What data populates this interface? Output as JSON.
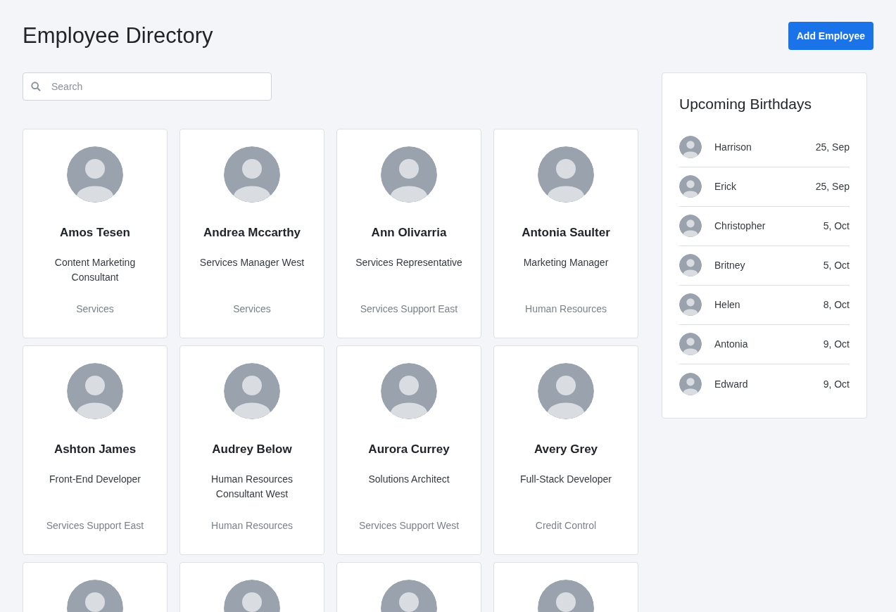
{
  "header": {
    "title": "Employee Directory",
    "add_button": "Add Employee"
  },
  "search": {
    "placeholder": "Search"
  },
  "cards": [
    {
      "kind": "full",
      "name": "Amos Tesen",
      "role": "Content Marketing Consultant",
      "department": "Services"
    },
    {
      "kind": "full",
      "name": "Andrea Mccarthy",
      "role": "Services Manager West",
      "department": "Services"
    },
    {
      "kind": "full",
      "name": "Ann Olivarria",
      "role": "Services Representative",
      "department": "Services Support East"
    },
    {
      "kind": "full",
      "name": "Antonia Saulter",
      "role": "Marketing Manager",
      "department": "Human Resources"
    },
    {
      "kind": "full",
      "name": "Ashton James",
      "role": "Front-End Developer",
      "department": "Services Support East"
    },
    {
      "kind": "full",
      "name": "Audrey Below",
      "role": "Human Resources Consultant West",
      "department": "Human Resources"
    },
    {
      "kind": "full",
      "name": "Aurora Currey",
      "role": "Solutions Architect",
      "department": "Services Support West"
    },
    {
      "kind": "full",
      "name": "Avery Grey",
      "role": "Full-Stack Developer",
      "department": "Credit Control"
    },
    {
      "kind": "cut"
    },
    {
      "kind": "cut"
    },
    {
      "kind": "cut"
    },
    {
      "kind": "cut"
    }
  ],
  "birthdays": {
    "title": "Upcoming Birthdays",
    "items": [
      {
        "name": "Harrison",
        "date": "25, Sep"
      },
      {
        "name": "Erick",
        "date": "25, Sep"
      },
      {
        "name": "Christopher",
        "date": "5, Oct"
      },
      {
        "name": "Britney",
        "date": "5, Oct"
      },
      {
        "name": "Helen",
        "date": "8, Oct"
      },
      {
        "name": "Antonia",
        "date": "9, Oct"
      },
      {
        "name": "Edward",
        "date": "9, Oct"
      }
    ]
  }
}
